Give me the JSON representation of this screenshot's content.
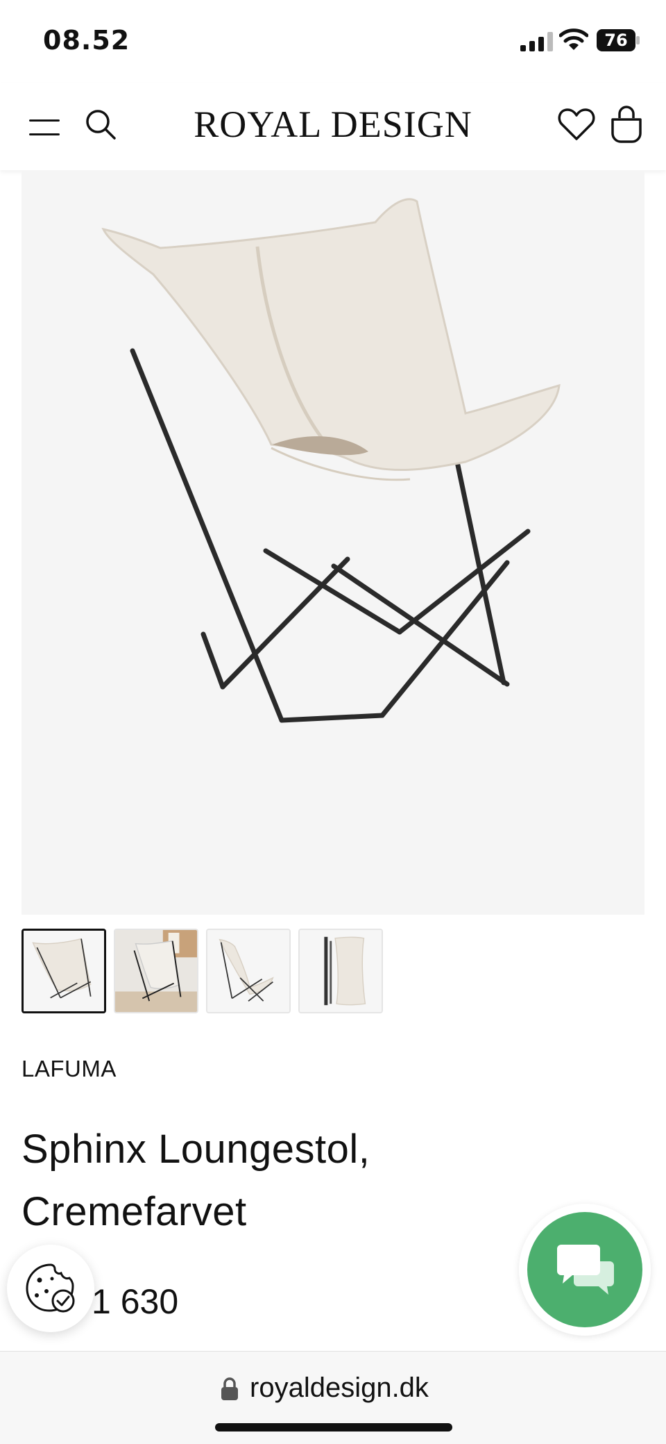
{
  "status_bar": {
    "time": "08.52",
    "battery_percent": "76",
    "icons": [
      "cellular-signal-icon",
      "wifi-icon",
      "battery-icon"
    ]
  },
  "header": {
    "brand": "ROYAL DESIGN",
    "icons": [
      "menu-icon",
      "search-icon",
      "heart-icon",
      "shopping-bag-icon"
    ]
  },
  "product": {
    "brand": "LAFUMA",
    "title": "Sphinx Loungestol, Cremefarvet",
    "price": "1 630",
    "gallery": {
      "selected_index": 0,
      "thumbnails": [
        "chair-front",
        "chair-in-room",
        "chair-side",
        "chair-folded"
      ]
    }
  },
  "floating": {
    "cookie_icon": "cookie-settings-icon",
    "chat_icon": "chat-bubbles-icon"
  },
  "browser": {
    "url": "royaldesign.dk",
    "lock_icon": "lock-icon"
  },
  "colors": {
    "chat_button": "#4caf6e",
    "image_background": "#f5f5f5",
    "text": "#111111"
  }
}
